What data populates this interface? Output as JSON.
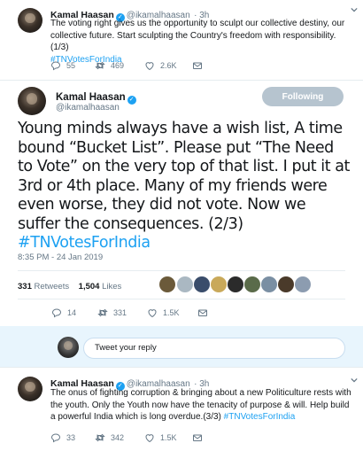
{
  "tweet1": {
    "name": "Kamal Haasan",
    "handle": "@ikamalhaasan",
    "time": "· 3h",
    "text": "The voting right gives us the opportunity to sculpt our collective destiny, our collective future. Start sculpting the Country's freedom with responsibility.(1/3)",
    "hashtag": "#TNVotesForIndia",
    "replies": "55",
    "retweets": "469",
    "likes": "2.6K"
  },
  "main_tweet": {
    "name": "Kamal Haasan",
    "handle": "@ikamalhaasan",
    "follow_label": "Following",
    "text": "Young minds always have a wish list, A time bound “Bucket List”. Please put “The Need to Vote” on the very top of that list. I put it at 3rd or 4th place. Many of my friends were even worse, they did not vote. Now we suffer the consequences. (2/3)",
    "hashtag": "#TNVotesForIndia",
    "timestamp": "8:35 PM - 24 Jan 2019",
    "retweets_count": "331",
    "retweets_label": "Retweets",
    "likes_count": "1,504",
    "likes_label": "Likes",
    "replies": "14",
    "retweets": "331",
    "likes": "1.5K"
  },
  "reply_box": {
    "placeholder": "Tweet your reply"
  },
  "tweet3": {
    "name": "Kamal Haasan",
    "handle": "@ikamalhaasan",
    "time": "· 3h",
    "text": "The onus of fighting corruption & bringing about a new Politiculture rests with the youth. Only the Youth now have the tenacity of purpose & will. Help build a powerful India which is long overdue.(3/3)",
    "hashtag": "#TNVotesForIndia",
    "replies": "33",
    "retweets": "342",
    "likes": "1.5K"
  },
  "colors": {
    "accent": "#1da1f2",
    "muted": "#657786",
    "follow_button": "#b6c4cf"
  },
  "icons": [
    "verified-badge-icon",
    "reply-icon",
    "retweet-icon",
    "like-icon",
    "message-icon",
    "chevron-down-icon"
  ]
}
